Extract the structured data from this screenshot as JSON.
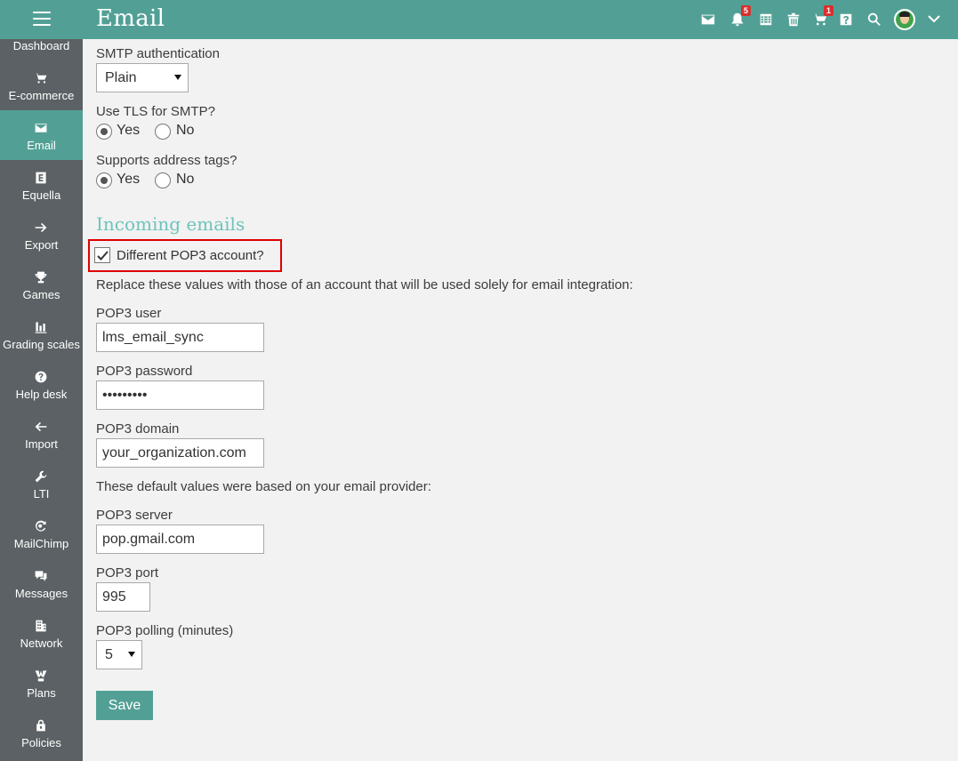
{
  "header": {
    "title": "Email",
    "icons": [
      {
        "name": "mail-icon"
      },
      {
        "name": "notifications-icon",
        "badge": "5"
      },
      {
        "name": "calendar-icon"
      },
      {
        "name": "trash-icon"
      },
      {
        "name": "cart-icon",
        "badge": "1"
      },
      {
        "name": "help-icon"
      },
      {
        "name": "search-icon"
      }
    ],
    "accent_color": "#52a095",
    "badge_color": "#d9302f"
  },
  "sidebar": {
    "background": "#5b6164",
    "items": [
      {
        "label": "Dashboard",
        "icon": "dashboard-icon",
        "active": false
      },
      {
        "label": "E-commerce",
        "icon": "cart-icon",
        "active": false
      },
      {
        "label": "Email",
        "icon": "envelope-icon",
        "active": true
      },
      {
        "label": "Equella",
        "icon": "equella-icon",
        "active": false
      },
      {
        "label": "Export",
        "icon": "arrow-right-icon",
        "active": false
      },
      {
        "label": "Games",
        "icon": "trophy-icon",
        "active": false
      },
      {
        "label": "Grading scales",
        "icon": "bar-chart-icon",
        "active": false
      },
      {
        "label": "Help desk",
        "icon": "question-circle-icon",
        "active": false
      },
      {
        "label": "Import",
        "icon": "arrow-left-icon",
        "active": false
      },
      {
        "label": "LTI",
        "icon": "wrench-icon",
        "active": false
      },
      {
        "label": "MailChimp",
        "icon": "mailchimp-icon",
        "active": false
      },
      {
        "label": "Messages",
        "icon": "chat-icon",
        "active": false
      },
      {
        "label": "Network",
        "icon": "building-icon",
        "active": false
      },
      {
        "label": "Plans",
        "icon": "plans-icon",
        "active": false
      },
      {
        "label": "Policies",
        "icon": "lock-icon",
        "active": false
      }
    ]
  },
  "form": {
    "smtp_auth": {
      "label": "SMTP authentication",
      "value": "Plain"
    },
    "use_tls": {
      "label": "Use TLS for SMTP?",
      "yes": "Yes",
      "no": "No",
      "selected": "Yes"
    },
    "address_tags": {
      "label": "Supports address tags?",
      "yes": "Yes",
      "no": "No",
      "selected": "Yes"
    },
    "incoming_title": "Incoming emails",
    "different_pop3": {
      "label": "Different POP3 account?",
      "checked": true
    },
    "replace_note": "Replace these values with those of an account that will be used solely for email integration:",
    "pop3_user": {
      "label": "POP3 user",
      "value": "lms_email_sync"
    },
    "pop3_password": {
      "label": "POP3 password",
      "value": "•••••••••"
    },
    "pop3_domain": {
      "label": "POP3 domain",
      "value": "your_organization.com"
    },
    "defaults_note": "These default values were based on your email provider:",
    "pop3_server": {
      "label": "POP3 server",
      "value": "pop.gmail.com"
    },
    "pop3_port": {
      "label": "POP3 port",
      "value": "995"
    },
    "pop3_polling": {
      "label": "POP3 polling (minutes)",
      "value": "5"
    },
    "save_label": "Save"
  }
}
